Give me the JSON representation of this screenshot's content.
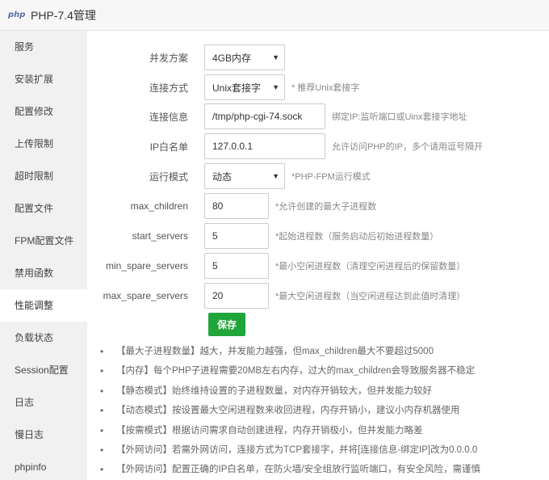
{
  "window": {
    "logo_text": "php",
    "title": "PHP-7.4管理"
  },
  "sidebar": {
    "items": [
      {
        "label": "服务",
        "active": false
      },
      {
        "label": "安装扩展",
        "active": false
      },
      {
        "label": "配置修改",
        "active": false
      },
      {
        "label": "上传限制",
        "active": false
      },
      {
        "label": "超时限制",
        "active": false
      },
      {
        "label": "配置文件",
        "active": false
      },
      {
        "label": "FPM配置文件",
        "active": false
      },
      {
        "label": "禁用函数",
        "active": false
      },
      {
        "label": "性能调整",
        "active": true
      },
      {
        "label": "负载状态",
        "active": false
      },
      {
        "label": "Session配置",
        "active": false
      },
      {
        "label": "日志",
        "active": false
      },
      {
        "label": "慢日志",
        "active": false
      },
      {
        "label": "phpinfo",
        "active": false
      }
    ]
  },
  "form": {
    "concurrency": {
      "label": "并发方案",
      "value": "4GB内存"
    },
    "conn_type": {
      "label": "连接方式",
      "value": "Unix套接字",
      "hint": "* 推荐Unix套接字"
    },
    "conn_info": {
      "label": "连接信息",
      "value": "/tmp/php-cgi-74.sock",
      "hint": "绑定IP:监听端口或Uinx套接字地址"
    },
    "ip_whitelist": {
      "label": "IP白名单",
      "value": "127.0.0.1",
      "hint": "允许访问PHP的IP，多个请用逗号隔开"
    },
    "run_mode": {
      "label": "运行模式",
      "value": "动态",
      "hint": "*PHP-FPM运行模式"
    },
    "max_children": {
      "label": "max_children",
      "value": "80",
      "hint": "*允许创建的最大子进程数"
    },
    "start_servers": {
      "label": "start_servers",
      "value": "5",
      "hint": "*起始进程数（服务启动后初始进程数量）"
    },
    "min_spare_servers": {
      "label": "min_spare_servers",
      "value": "5",
      "hint": "*最小空闲进程数（清理空闲进程后的保留数量）"
    },
    "max_spare_servers": {
      "label": "max_spare_servers",
      "value": "20",
      "hint": "*最大空闲进程数（当空闲进程达到此值时清理）"
    },
    "save_label": "保存"
  },
  "tips": [
    "【最大子进程数量】越大，并发能力越强，但max_children最大不要超过5000",
    "【内存】每个PHP子进程需要20MB左右内存，过大的max_children会导致服务器不稳定",
    "【静态模式】始终维持设置的子进程数量，对内存开销较大，但并发能力较好",
    "【动态模式】按设置最大空闲进程数来收回进程，内存开销小，建议小内存机器使用",
    "【按需模式】根据访问需求自动创建进程，内存开销极小，但并发能力略差",
    "【外网访问】若需外网访问，连接方式为TCP套接字，并将[连接信息-绑定IP]改为0.0.0.0",
    "【外网访问】配置正确的IP白名单，在防火墙/安全组放行监听端口，有安全风险，需谨慎"
  ],
  "colors": {
    "primary_button": "#20a53a",
    "sidebar_bg": "#f1f1f1"
  },
  "icons": {
    "select_arrow": "chevron-down-icon"
  }
}
